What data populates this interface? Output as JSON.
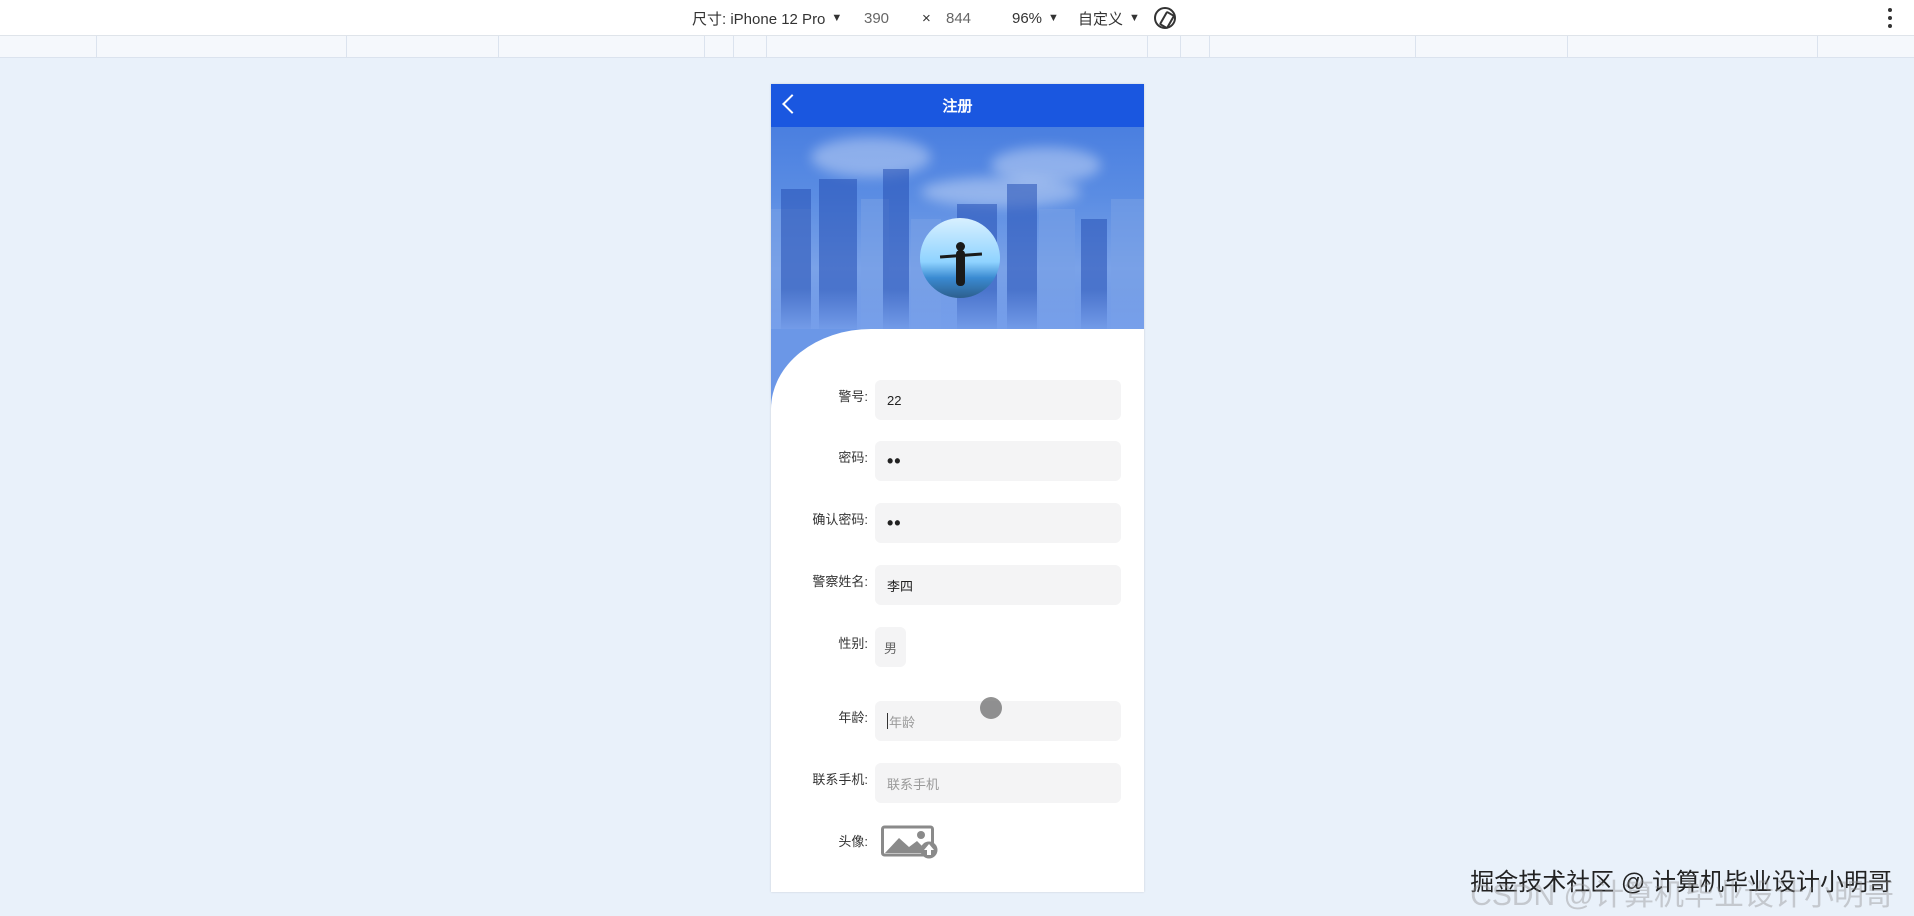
{
  "devtools": {
    "size_label": "尺寸: iPhone 12 Pro",
    "width": "390",
    "times": "×",
    "height": "844",
    "zoom": "96%",
    "throttle": "自定义",
    "caret": "▼"
  },
  "page": {
    "title": "注册"
  },
  "form": {
    "badge_label": "警号:",
    "badge_value": "22",
    "password_label": "密码:",
    "password_value": "••",
    "confirm_label": "确认密码:",
    "confirm_value": "••",
    "name_label": "警察姓名:",
    "name_value": "李四",
    "gender_label": "性别:",
    "gender_value": "男",
    "age_label": "年龄:",
    "age_placeholder": "年龄",
    "phone_label": "联系手机:",
    "phone_placeholder": "联系手机",
    "avatar_label": "头像:"
  },
  "watermark": {
    "text": "掘金技术社区 @ 计算机毕业设计小明哥",
    "faint_text": "CSDN @计算机毕业设计小明哥"
  },
  "icons": {
    "back": "back-icon",
    "rotate": "rotate-icon",
    "more": "more-vertical-icon",
    "upload": "image-upload-icon"
  },
  "colors": {
    "nav": "#1a57e0",
    "page_bg": "#e9f1fa",
    "field_bg": "#f4f4f5"
  }
}
